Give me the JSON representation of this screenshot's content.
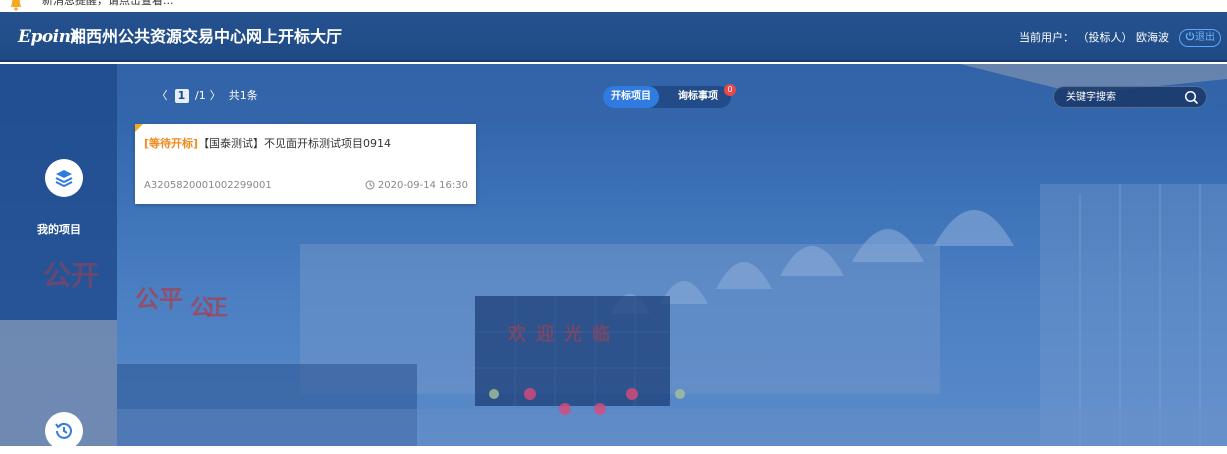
{
  "notice": {
    "text": "新消息提醒，请点击查看..."
  },
  "header": {
    "logo": "Epoint",
    "title": "湘西州公共资源交易中心网上开标大厅",
    "user_label": "当前用户：",
    "user_role": "（投标人）",
    "user_name": "欧海波",
    "logout_label": "退出"
  },
  "sidebar": {
    "items": [
      {
        "label": "我的项目",
        "icon": "layers-icon"
      },
      {
        "label": "",
        "icon": "history-icon"
      }
    ],
    "decorations": [
      "公开",
      "公平",
      "公正",
      "欢迎光临"
    ]
  },
  "pager": {
    "prev": "〈",
    "current": "1",
    "total": "/1",
    "next": "〉",
    "count": "共1条"
  },
  "tabs": [
    {
      "label": "开标项目",
      "active": true
    },
    {
      "label": "询标事项",
      "active": false,
      "badge": "0"
    }
  ],
  "search": {
    "placeholder": "关键字搜索",
    "value": ""
  },
  "projects": [
    {
      "status": "[等待开标]",
      "name": "【国泰测试】不见面开标测试项目0914",
      "code": "A3205820001002299001",
      "time": "2020-09-14 16:30"
    }
  ],
  "colors": {
    "header": "#25528f",
    "accent": "#2f7be0",
    "status": "#f08a1c",
    "badge": "#e8474c"
  }
}
